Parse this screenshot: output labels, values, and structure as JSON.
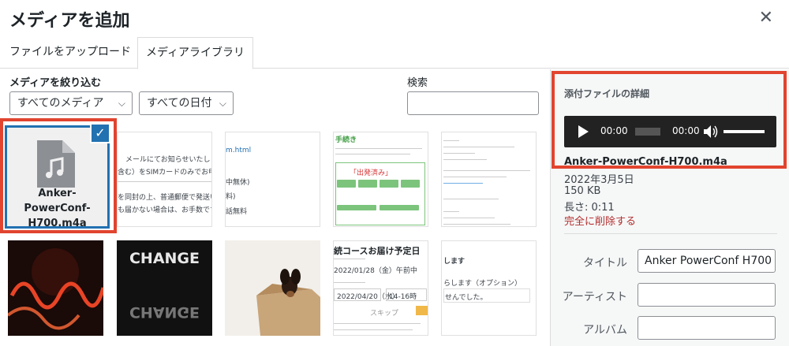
{
  "modal": {
    "title": "メディアを追加"
  },
  "tabs": {
    "upload": "ファイルをアップロード",
    "library": "メディアライブラリ"
  },
  "filter": {
    "label": "メディアを絞り込む",
    "media_select": "すべてのメディア",
    "date_select": "すべての日付"
  },
  "search": {
    "label": "検索",
    "value": ""
  },
  "grid": {
    "selected_item": {
      "filename": "Anker-PowerConf-H700.m4a"
    },
    "thumb2": {
      "line1": "メールにてお知らせいたします。",
      "line2": "含む）をSIMカードのみでお申し込み",
      "line3": "を同封の上、普通郵便で発送いたしま",
      "line4": "も届かない場合は、お手数です"
    },
    "thumb3": {
      "link": "m.html",
      "line1": "中無休)",
      "line2": "料)",
      "line3": "話無料"
    },
    "thumb4": {
      "heading": "手続き",
      "highlight": "「出発済み」"
    },
    "thumb7": {
      "word": "CHANGE"
    },
    "thumb9": {
      "heading": "続コースお届け予定日",
      "date1": "2022/01/28（金）午前中",
      "date2": "2022/04/20（水）",
      "slot": "14-16時",
      "button": "スキップ"
    },
    "thumb10": {
      "line1": "します",
      "line2": "らします（オプション）",
      "line3": "せんでした。"
    }
  },
  "details": {
    "title": "添付ファイルの詳細",
    "player": {
      "current": "00:00",
      "duration": "00:00"
    },
    "filename": "Anker-PowerConf-H700.m4a",
    "date": "2022年3月5日",
    "size": "150 KB",
    "length": "長さ: 0:11",
    "delete": "完全に削除する",
    "fields": {
      "title_label": "タイトル",
      "title_value": "Anker PowerConf H700",
      "artist_label": "アーティスト",
      "artist_value": "",
      "album_label": "アルバム",
      "album_value": ""
    }
  },
  "colors": {
    "highlight": "#e1442f",
    "accent": "#2271b1",
    "danger": "#b32d2e"
  }
}
